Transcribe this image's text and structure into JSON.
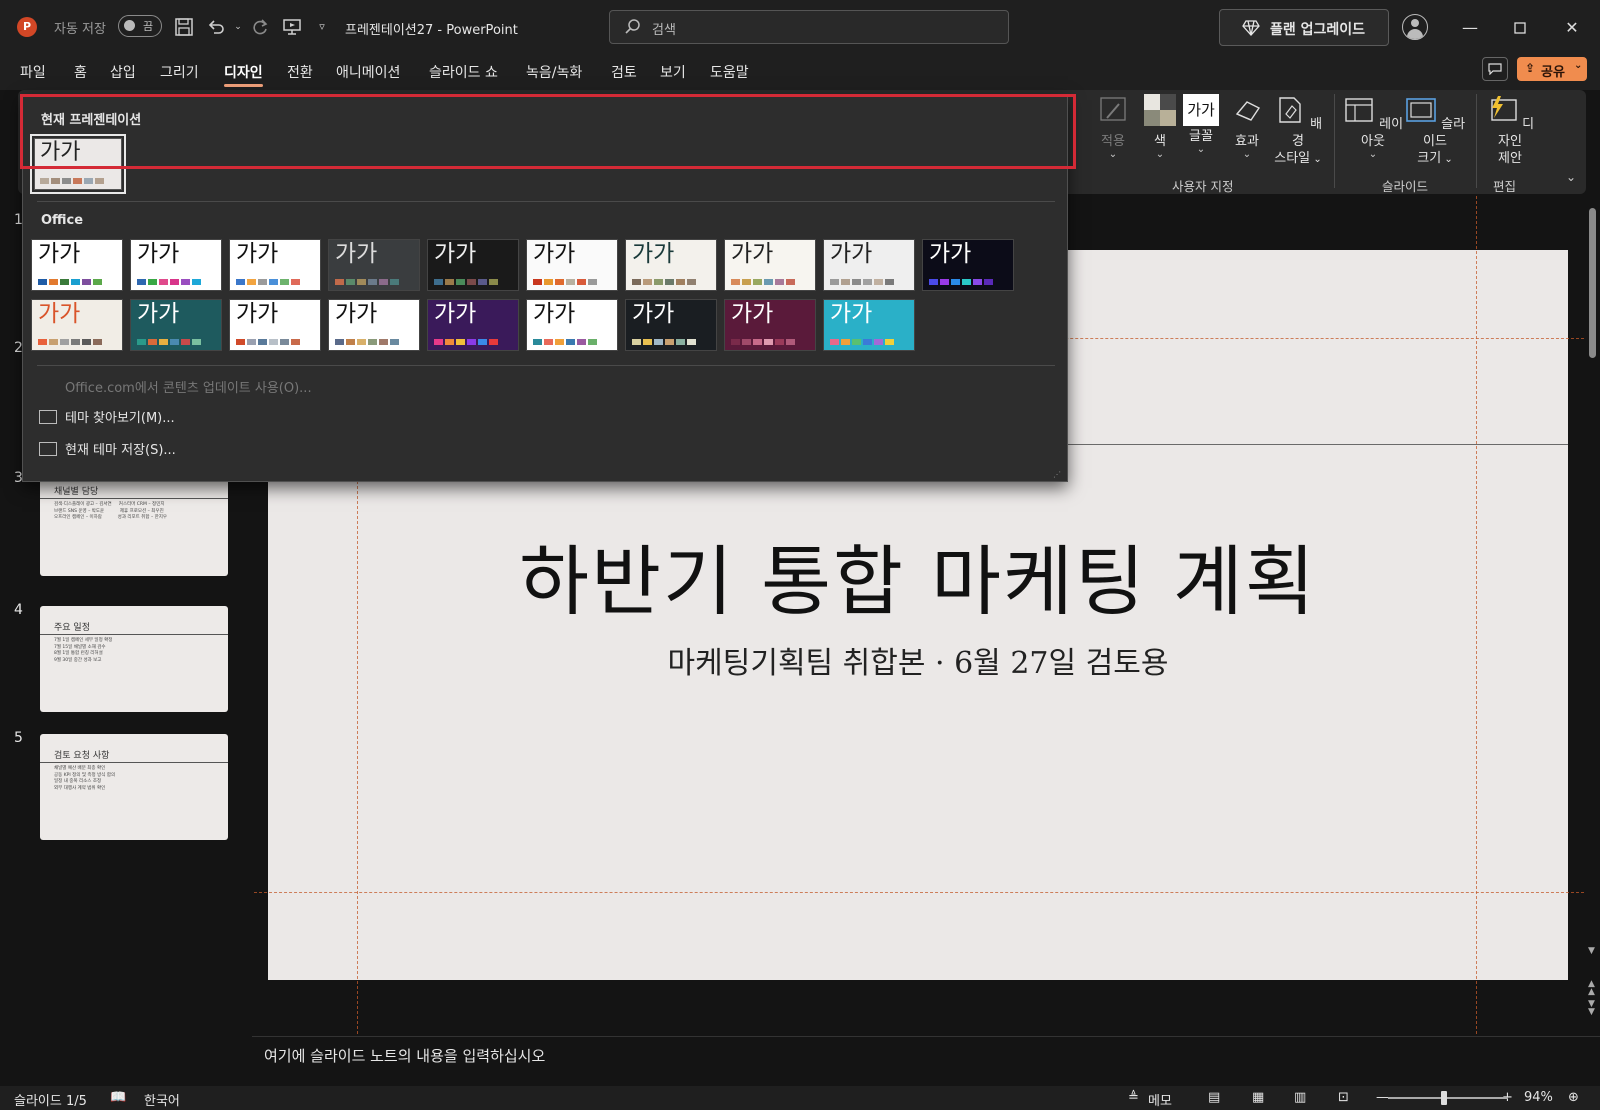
{
  "titlebar": {
    "logo": "P",
    "autosave_label": "자동 저장",
    "autosave_state": "끔",
    "doc_title": "프레젠테이션27  -  PowerPoint",
    "search_placeholder": "검색",
    "upgrade_label": "플랜 업그레이드",
    "icons": [
      "save-icon",
      "undo-icon",
      "redo-icon",
      "present-icon",
      "customize-icon"
    ]
  },
  "menu": {
    "tabs": [
      "파일",
      "홈",
      "삽입",
      "그리기",
      "디자인",
      "전환",
      "애니메이션",
      "슬라이드 쇼",
      "녹음/녹화",
      "검토",
      "보기",
      "도움말"
    ],
    "active_tab": "디자인",
    "share_label": "공유"
  },
  "ribbon": {
    "buttons": {
      "apply": "적용",
      "color": "색",
      "font": "글꼴",
      "font_sample": "가가",
      "effects": "효과",
      "bg_style_1": "배경",
      "bg_style_2": "스타일",
      "layout": "레이아웃",
      "slide_size_1": "슬라이드",
      "slide_size_2": "크기",
      "designer_1": "디자인",
      "designer_2": "제안"
    },
    "groups": [
      "사용자 지정",
      "슬라이드",
      "편집"
    ]
  },
  "theme_dropdown": {
    "current_header": "현재 프레젠테이션",
    "office_header": "Office",
    "sample_text": "가가",
    "current_theme": {
      "bg": "#ebe8e7",
      "text": "#222222",
      "bars": [
        "#b7a99a",
        "#a38e7c",
        "#8c8c8c",
        "#c8785a",
        "#9aa7b3",
        "#b3a08f"
      ]
    },
    "themes": [
      {
        "bg": "#ffffff",
        "text": "#111111",
        "bars": [
          "#1f5ca6",
          "#e27a2f",
          "#3a7a3a",
          "#1a9fd0",
          "#7e4e9e",
          "#5ba84a"
        ]
      },
      {
        "bg": "#ffffff",
        "text": "#111111",
        "bars": [
          "#2e68b0",
          "#39a845",
          "#e04a8c",
          "#d8358a",
          "#9a4ec0",
          "#1ea8d8"
        ]
      },
      {
        "bg": "#ffffff",
        "text": "#111111",
        "bars": [
          "#3b77c9",
          "#f2a440",
          "#9b9b9b",
          "#4a90d9",
          "#6db36d",
          "#e06a5a"
        ]
      },
      {
        "bg": "#3a3d3f",
        "text": "#dcdcdc",
        "bars": [
          "#c06a4a",
          "#5a8a6a",
          "#a08a5a",
          "#6a7a8a",
          "#8a6a8a",
          "#4a7a7a"
        ]
      },
      {
        "bg": "#1a1a1a",
        "text": "#eeeeee",
        "bars": [
          "#3e6e8e",
          "#9a7a4a",
          "#4a8a5a",
          "#7a4a4a",
          "#5a5a8a",
          "#8a8a4a"
        ]
      },
      {
        "bg": "#fafafa",
        "text": "#111111",
        "bars": [
          "#c8371e",
          "#e8982e",
          "#e06a2e",
          "#b8b0a0",
          "#d85a3a",
          "#9a9a9a"
        ]
      },
      {
        "bg": "#f3f1ec",
        "text": "#1a3a3a",
        "bars": [
          "#7a6a5a",
          "#b89a7a",
          "#8a9a6a",
          "#6a7a6a",
          "#a08060",
          "#908070"
        ]
      },
      {
        "bg": "#f7f5f0",
        "text": "#222222",
        "bars": [
          "#d88a5a",
          "#c8a050",
          "#98a860",
          "#6a9ab0",
          "#a87a9a",
          "#c86a5a"
        ]
      },
      {
        "bg": "#efefef",
        "text": "#222222",
        "bars": [
          "#9a9a9a",
          "#b0a090",
          "#8a8a8a",
          "#a0a0a0",
          "#c0b0a0",
          "#7a7a7a"
        ]
      },
      {
        "bg": "#0c0c18",
        "text": "#ffffff",
        "bars": [
          "#4a4ae8",
          "#9a3ae8",
          "#2a8ae8",
          "#2ac8c8",
          "#8a4ae8",
          "#5a2ab8"
        ]
      },
      {
        "bg": "#f1ede6",
        "text": "#d9542a",
        "bars": [
          "#e8603a",
          "#c8a070",
          "#a0a0a0",
          "#7a7a7a",
          "#5a5a5a",
          "#8a6a5a"
        ]
      },
      {
        "bg": "#1e5a5e",
        "text": "#ffffff",
        "bars": [
          "#2a9a8a",
          "#d86a3a",
          "#e8b040",
          "#4a8ab0",
          "#c84a4a",
          "#7ac0a0"
        ]
      },
      {
        "bg": "#ffffff",
        "text": "#111111",
        "bars": [
          "#d04a2a",
          "#9aa0b0",
          "#5a7a9a",
          "#b8c0c8",
          "#7a8a9a",
          "#c86a4a"
        ]
      },
      {
        "bg": "#ffffff",
        "text": "#111111",
        "bars": [
          "#5a6a8a",
          "#c0804a",
          "#d8b06a",
          "#8a9a7a",
          "#a07a6a",
          "#6a8aa0"
        ]
      },
      {
        "bg": "#3a1a5a",
        "text": "#ffffff",
        "bars": [
          "#e83a8a",
          "#f08a3a",
          "#f0c03a",
          "#8a3ae8",
          "#3a8ae8",
          "#e83a3a"
        ]
      },
      {
        "bg": "#ffffff",
        "text": "#111111",
        "bars": [
          "#2a8a9a",
          "#e86a5a",
          "#f0a03a",
          "#3a7ab0",
          "#9a5aa0",
          "#6ab06a"
        ]
      },
      {
        "bg": "#1a1e22",
        "text": "#ffffff",
        "bars": [
          "#d8d0a0",
          "#e8c050",
          "#a0b8c8",
          "#c8a070",
          "#8ab0a0",
          "#e0e0d0"
        ]
      },
      {
        "bg": "#5a1a3a",
        "text": "#ffffff",
        "bars": [
          "#7a2a4a",
          "#a04a6a",
          "#c86a8a",
          "#e09ab0",
          "#9a3a5a",
          "#b05a7a"
        ]
      },
      {
        "bg": "#2ab0c8",
        "text": "#ffffff",
        "bars": [
          "#e86a8a",
          "#f0a03a",
          "#5ac070",
          "#3a7ad8",
          "#a06ad8",
          "#f0d03a"
        ]
      }
    ],
    "online_updates": "Office.com에서 콘텐츠 업데이트 사용(O)...",
    "browse_themes": "테마 찾아보기(M)...",
    "save_theme": "현재 테마 저장(S)..."
  },
  "slides_panel": {
    "numbers": [
      "1",
      "2",
      "3",
      "4",
      "5"
    ],
    "thumbs": [
      {
        "title": "채널별 담당",
        "body": "검색·디스플레이 광고 – 김서연     커스터머 CRM – 정민지\n브랜드 SNS 운영 – 박도윤           제휴 프로모션 – 최우진\n오프라인 캠페인 – 이하람           성과 리포트 취합 – 한지우"
      },
      {
        "title": "주요 일정",
        "body": "7월 1일 캠페인 세부 일정 확정\n7월 15일 채널별 소재 검수\n8월 1일 통합 런칭 리허설\n9월 30일 중간 성과 보고"
      },
      {
        "title": "검토 요청 사항",
        "body": "채널별 예산 배분 최종 확인\n공동 KPI 정의 및 측정 방식 합의\n일정 내 중복 리소스 조정\n외부 대행사 계약 범위 확인"
      }
    ]
  },
  "slide": {
    "title": "하반기 통합 마케팅 계획",
    "subtitle": "마케팅기획팀 취합본 · 6월 27일 검토용"
  },
  "notes_placeholder": "여기에 슬라이드 노트의 내용을 입력하십시오",
  "statusbar": {
    "slide_counter": "슬라이드 1/5",
    "language": "한국어",
    "notes_label": "메모",
    "zoom_level": "94%",
    "zoom_fraction": 0.47
  }
}
